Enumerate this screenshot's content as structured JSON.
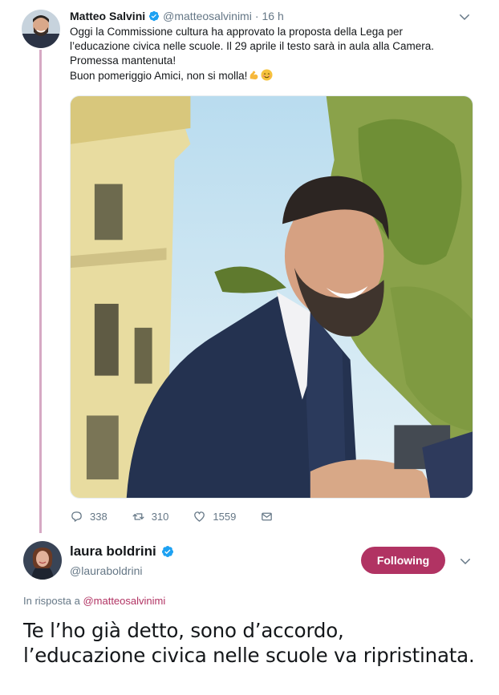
{
  "tweet": {
    "author_name": "Matteo Salvini",
    "handle": "@matteosalvinimi",
    "separator": "·",
    "time": "16 h",
    "lines": [
      "Oggi la Commissione cultura ha approvato la proposta della Lega per",
      "l’educazione civica nelle scuole. Il 29 aprile il testo sarà in aula alla Camera.",
      "Promessa mantenuta!",
      "Buon pomeriggio Amici, non si molla!"
    ],
    "emojis": [
      "flexed-biceps",
      "smiling-face"
    ],
    "actions": {
      "replies": "338",
      "retweets": "310",
      "likes": "1559"
    }
  },
  "reply": {
    "author_name": "laura boldrini",
    "handle": "@lauraboldrini",
    "follow_label": "Following",
    "reply_prefix": "In risposta a",
    "reply_mention": "@matteosalvinimi",
    "lines": [
      "Te l’ho già detto, sono d’accordo,",
      "l’educazione civica nelle scuole va ripristinata."
    ]
  },
  "colors": {
    "accent": "#b13363",
    "thread_line": "#d6a9c4",
    "verified": "#1da1f2",
    "muted_text": "#657786"
  }
}
